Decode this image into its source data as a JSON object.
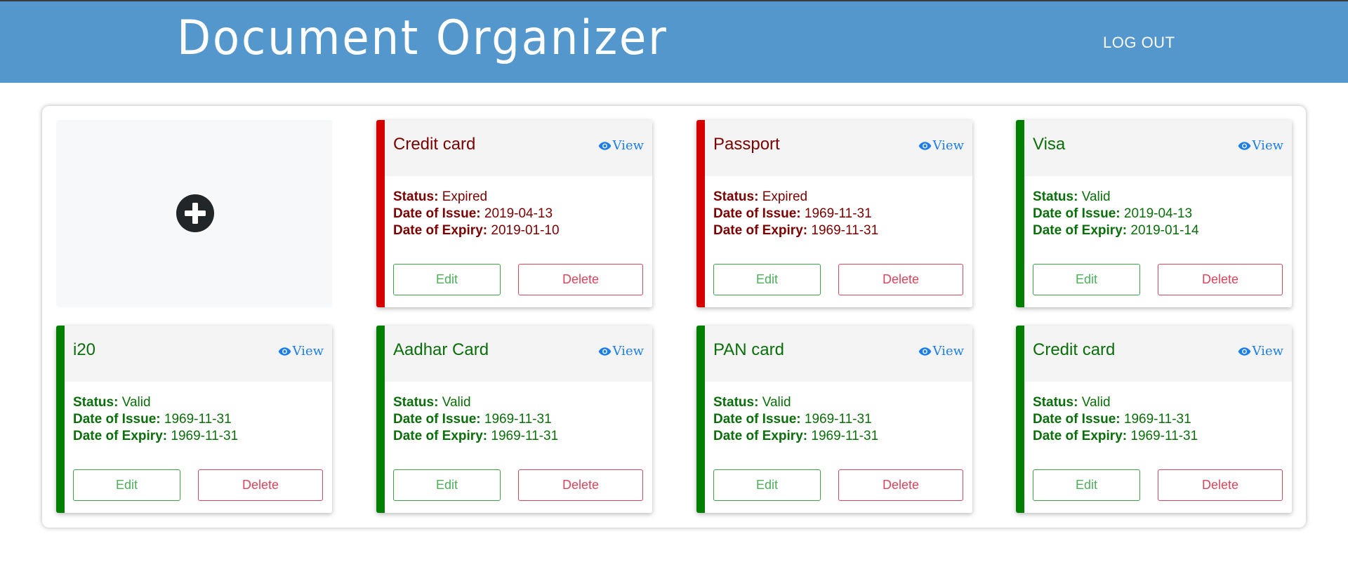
{
  "header": {
    "title": "Document Organizer",
    "logout_label": "LOG OUT",
    "background_color": "#5497cc"
  },
  "add_tile": {
    "icon": "plus-circle-icon"
  },
  "colors": {
    "expired": "#d50000",
    "expired_text": "#7b0000",
    "valid": "#007f00",
    "valid_text": "#0a6e0a",
    "link": "#1e7ee8",
    "edit": "#3aa14a",
    "delete": "#d9455a"
  },
  "labels": {
    "view": "View",
    "status": "Status:",
    "issue": "Date of Issue:",
    "expiry": "Date of Expiry:",
    "edit": "Edit",
    "delete": "Delete"
  },
  "documents": [
    {
      "title": "Credit card",
      "status": "Expired",
      "issue": "2019-04-13",
      "expiry": "2019-01-10"
    },
    {
      "title": "Passport",
      "status": "Expired",
      "issue": "1969-11-31",
      "expiry": "1969-11-31"
    },
    {
      "title": "Visa",
      "status": "Valid",
      "issue": "2019-04-13",
      "expiry": "2019-01-14"
    },
    {
      "title": "i20",
      "status": "Valid",
      "issue": "1969-11-31",
      "expiry": "1969-11-31"
    },
    {
      "title": "Aadhar Card",
      "status": "Valid",
      "issue": "1969-11-31",
      "expiry": "1969-11-31"
    },
    {
      "title": "PAN card",
      "status": "Valid",
      "issue": "1969-11-31",
      "expiry": "1969-11-31"
    },
    {
      "title": "Credit card",
      "status": "Valid",
      "issue": "1969-11-31",
      "expiry": "1969-11-31"
    }
  ]
}
